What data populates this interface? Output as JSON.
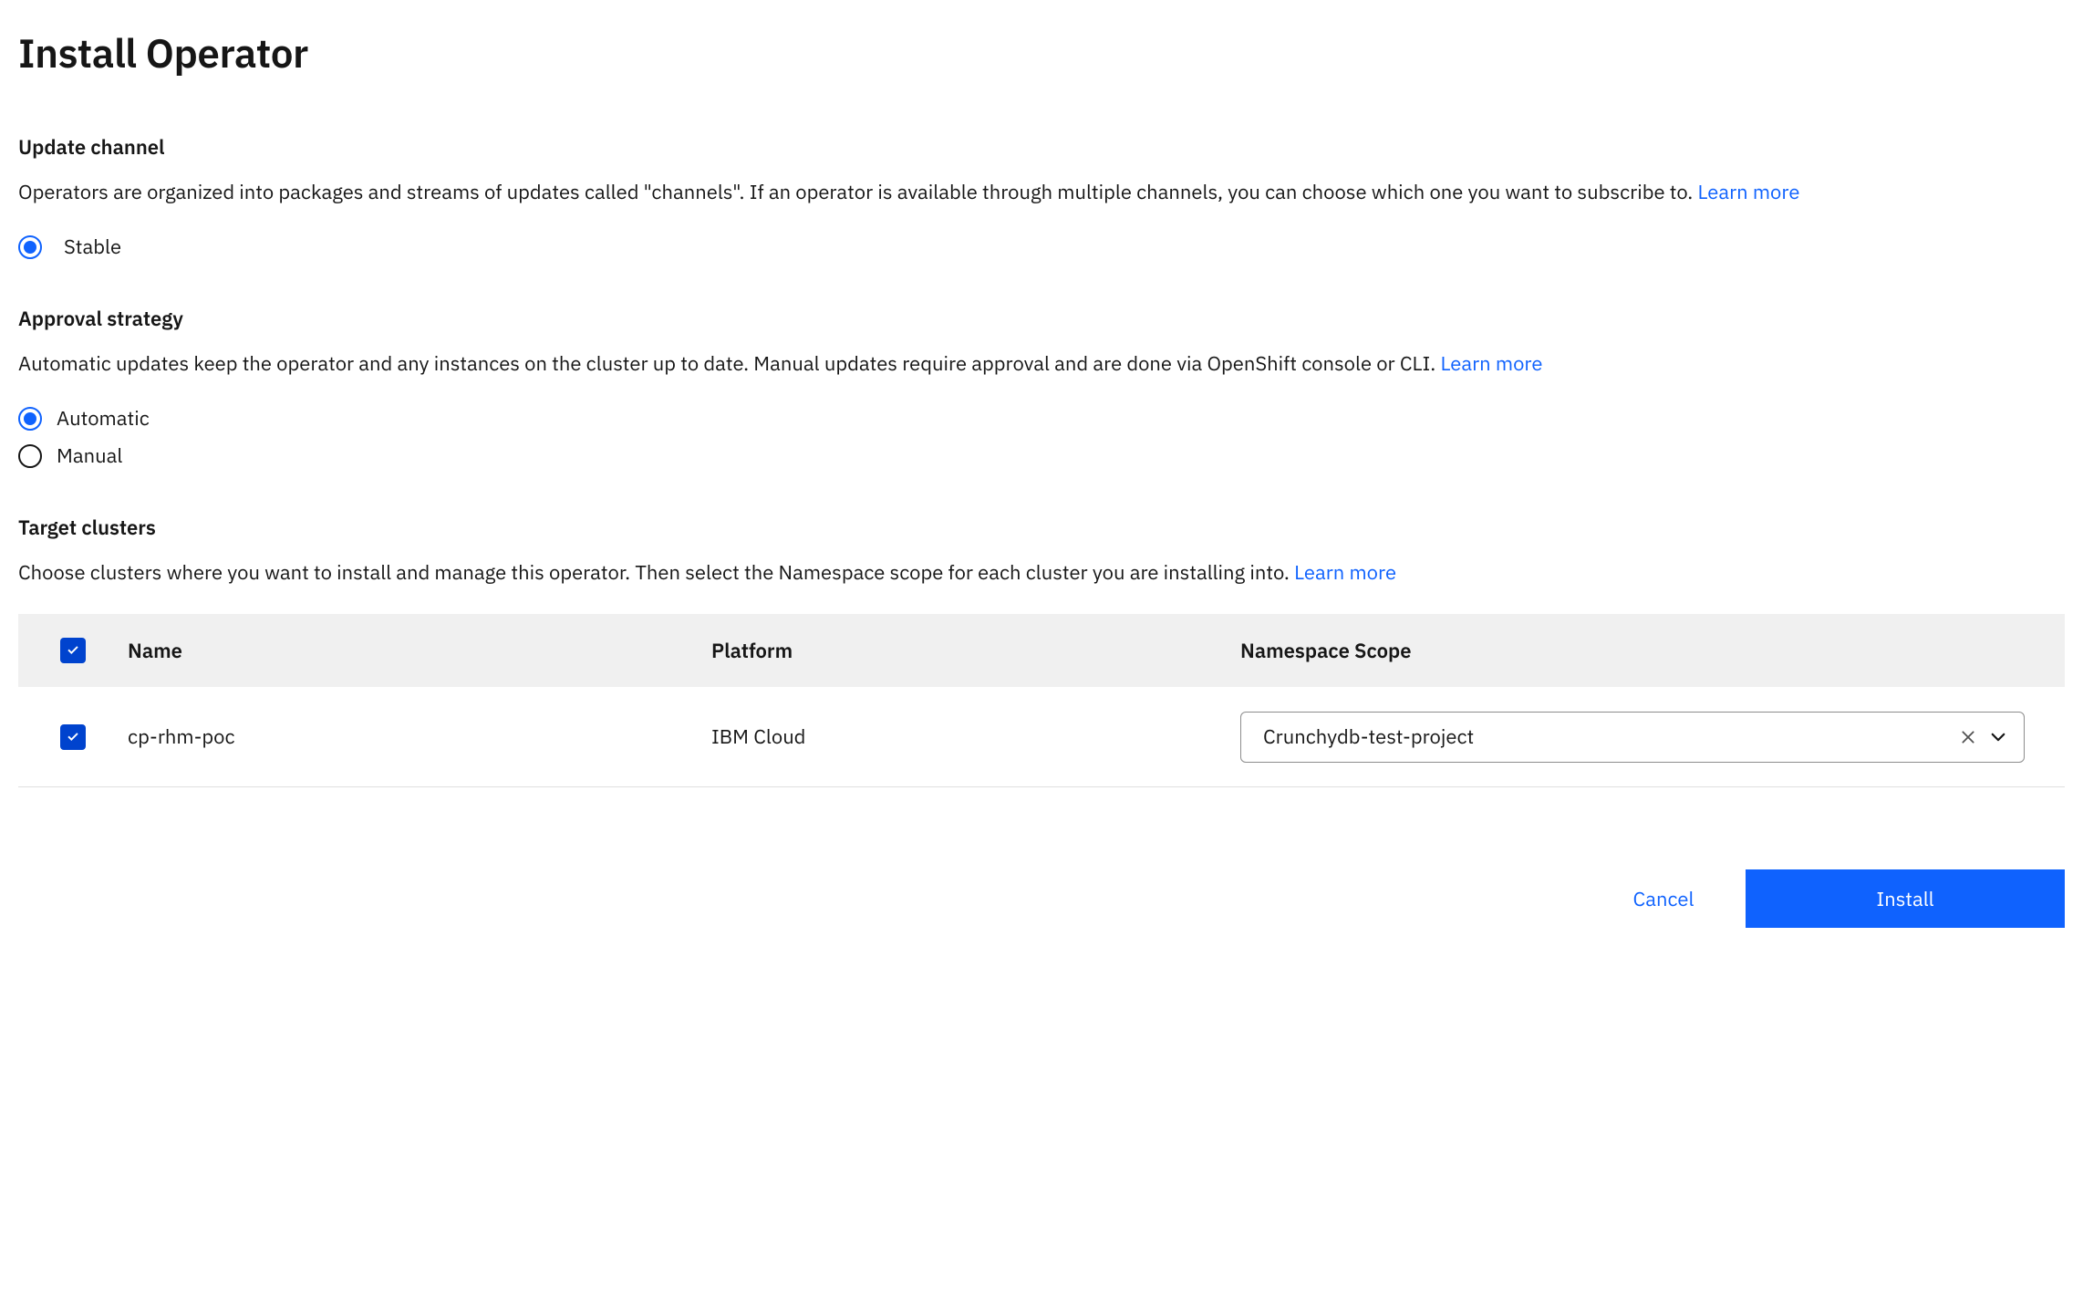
{
  "page": {
    "title": "Install Operator"
  },
  "updateChannel": {
    "heading": "Update channel",
    "description": "Operators are organized into packages and streams of updates called \"channels\". If an operator is available through multiple channels, you can choose which one you want to subscribe to. ",
    "learnMore": "Learn more",
    "options": {
      "stable": "Stable"
    }
  },
  "approvalStrategy": {
    "heading": "Approval strategy",
    "description": "Automatic updates keep the operator and any instances on the cluster up to date. Manual updates require approval and are done via OpenShift console or CLI. ",
    "learnMore": "Learn more",
    "options": {
      "automatic": "Automatic",
      "manual": "Manual"
    }
  },
  "targetClusters": {
    "heading": "Target clusters",
    "description": "Choose clusters where you want to install and manage this operator. Then select the Namespace scope for each cluster you are installing into. ",
    "learnMore": "Learn more",
    "columns": {
      "name": "Name",
      "platform": "Platform",
      "namespaceScope": "Namespace Scope"
    },
    "rows": [
      {
        "name": "cp-rhm-poc",
        "platform": "IBM Cloud",
        "namespaceScope": "Crunchydb-test-project"
      }
    ]
  },
  "actions": {
    "cancel": "Cancel",
    "install": "Install"
  }
}
